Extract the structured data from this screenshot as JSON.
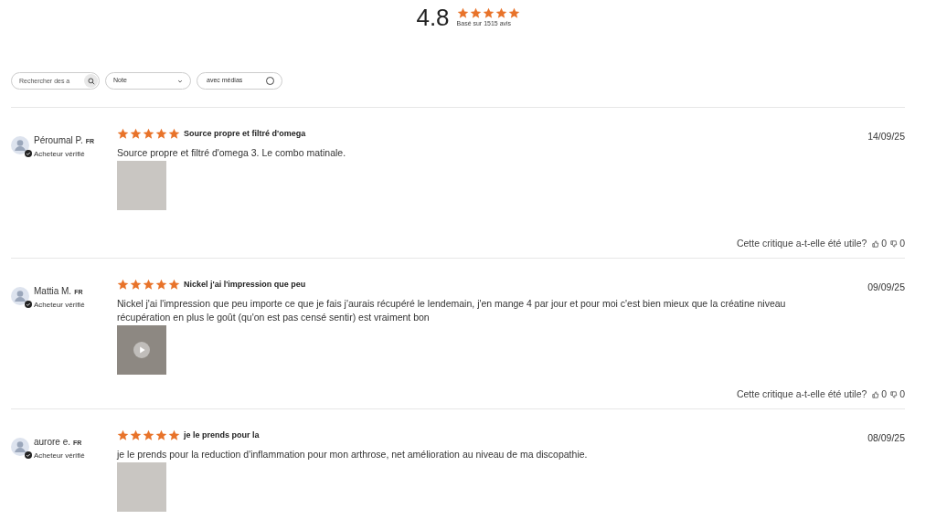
{
  "summary": {
    "score": "4.8",
    "stars": 5,
    "caption": "Basé sur 1515 avis"
  },
  "filters": {
    "search": {
      "placeholder": "Rechercher des a"
    },
    "rating": {
      "label": "Note"
    },
    "media": {
      "label": "avec médias",
      "checked": false
    }
  },
  "reviews": [
    {
      "author": "Péroumal P.",
      "country": "FR",
      "verified": "Acheteur vérifié",
      "stars": 5,
      "title": "Source propre et filtré d'omega",
      "date": "14/09/25",
      "body": "Source propre et filtré d'omega 3. Le combo matinale.",
      "media": {
        "kind": "photo"
      },
      "helpful": {
        "question": "Cette critique a-t-elle été utile?",
        "up": "0",
        "down": "0"
      }
    },
    {
      "author": "Mattia M.",
      "country": "FR",
      "verified": "Acheteur vérifié",
      "stars": 5,
      "title": "Nickel j'ai l'impression que peu",
      "date": "09/09/25",
      "body": "Nickel j'ai l'impression que peu importe ce que je fais j'aurais récupéré le lendemain, j'en mange 4 par jour et pour moi c'est bien mieux que la créatine niveau récupération en plus le goût (qu'on est pas censé sentir) est vraiment bon",
      "media": {
        "kind": "video"
      },
      "helpful": {
        "question": "Cette critique a-t-elle été utile?",
        "up": "0",
        "down": "0"
      }
    },
    {
      "author": "aurore e.",
      "country": "FR",
      "verified": "Acheteur vérifié",
      "stars": 5,
      "title": "je le prends pour la",
      "date": "08/09/25",
      "body": "je le prends pour la reduction d'inflammation pour mon arthrose, net amélioration au niveau de ma discopathie.",
      "media": {
        "kind": "photo"
      }
    }
  ]
}
